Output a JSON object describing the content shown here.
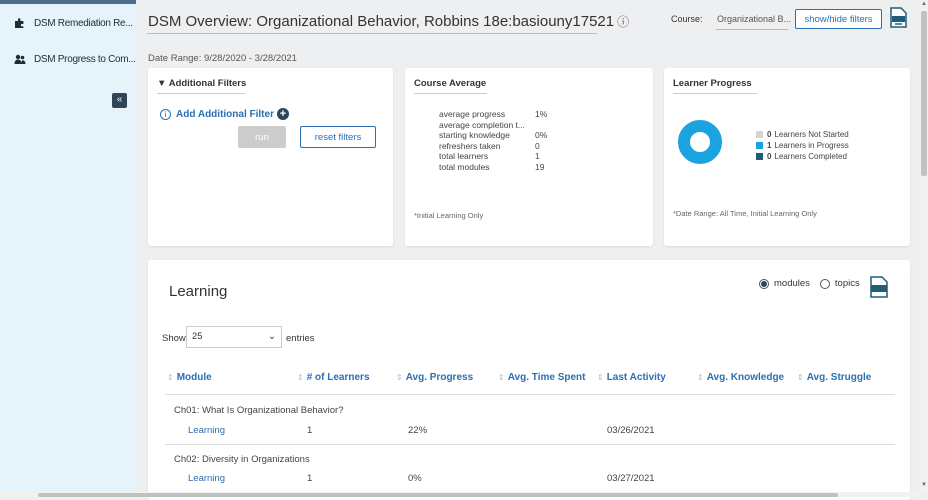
{
  "sidebar": {
    "items": [
      {
        "label": "DSM Remediation Re...",
        "icon": "puzzle-icon"
      },
      {
        "label": "DSM Progress to Com...",
        "icon": "users-icon"
      }
    ],
    "collapse_glyph": "«"
  },
  "header": {
    "title": "DSM Overview: Organizational Behavior, Robbins 18e:basiouny17521",
    "info_glyph": "ⓘ",
    "course_label": "Course:",
    "course_value": "Organizational B...",
    "showhide_label": "show/hide filters",
    "date_range": "Date Range: 9/28/2020 - 3/28/2021"
  },
  "filters": {
    "title": "Additional Filters",
    "add_label": "Add Additional Filter",
    "run_label": "run",
    "reset_label": "reset filters"
  },
  "course_average": {
    "title": "Course Average",
    "rows": [
      {
        "k": "average progress",
        "v": "1%"
      },
      {
        "k": "average completion t...",
        "v": ""
      },
      {
        "k": "starting knowledge",
        "v": "0%"
      },
      {
        "k": "refreshers taken",
        "v": "0"
      },
      {
        "k": "total learners",
        "v": "1"
      },
      {
        "k": "total modules",
        "v": "19"
      }
    ],
    "footnote": "*Initial Learning Only"
  },
  "learner_progress": {
    "title": "Learner Progress",
    "legend": [
      {
        "count": "0",
        "label": "Learners Not Started",
        "color": "#d4d4d4"
      },
      {
        "count": "1",
        "label": "Learners in Progress",
        "color": "#1aa3df"
      },
      {
        "count": "0",
        "label": "Learners Completed",
        "color": "#1f5d7a"
      }
    ],
    "footnote": "*Date Range: All Time, Initial Learning Only"
  },
  "learning": {
    "title": "Learning",
    "radio_modules": "modules",
    "radio_topics": "topics",
    "show_label": "Show",
    "show_value": "25",
    "entries_label": "entries",
    "columns": [
      "Module",
      "# of Learners",
      "Avg. Progress",
      "Avg. Time Spent",
      "Last Activity",
      "Avg. Knowledge",
      "Avg. Struggle"
    ],
    "rows": [
      {
        "module": "Ch01: What Is Organizational Behavior?",
        "type": "Learning",
        "learners": "1",
        "progress": "22%",
        "last_activity": "03/26/2021"
      },
      {
        "module": "Ch02: Diversity in Organizations",
        "type": "Learning",
        "learners": "1",
        "progress": "0%",
        "last_activity": "03/27/2021"
      }
    ]
  },
  "colors": {
    "accent": "#2d6fb0",
    "navy": "#2e4457",
    "donut": "#1aa3df"
  }
}
